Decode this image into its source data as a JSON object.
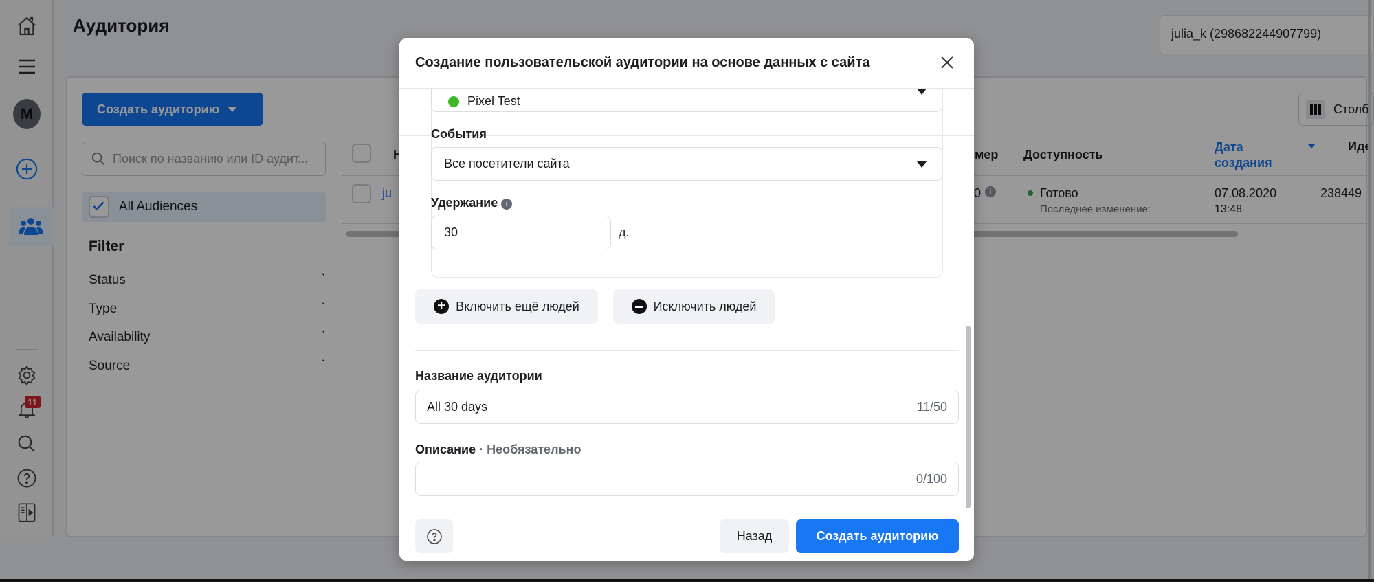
{
  "page": {
    "title": "Аудитория",
    "account": "julia_k (298682244907799)"
  },
  "nav": {
    "avatar_letter": "M",
    "notifications": "11"
  },
  "toolbar": {
    "create_label": "Создать аудиторию",
    "columns_label": "Столб"
  },
  "sidebar": {
    "search_placeholder": "Поиск по названию или ID аудит...",
    "all_audiences": "All Audiences",
    "filter_title": "Filter",
    "filters": [
      "Status",
      "Type",
      "Availability",
      "Source"
    ]
  },
  "table": {
    "headers": {
      "name": "Н",
      "size": "мер",
      "availability": "Доступность",
      "date": "Дата создания",
      "id": "Иде"
    },
    "rows": [
      {
        "name": "ju",
        "size": "0",
        "status": "Готово",
        "status_sub": "Последнее изменение:",
        "date": "07.08.2020",
        "time": "13:48",
        "id": "238449"
      }
    ]
  },
  "colors": {
    "accent": "#1877f2",
    "status_ready": "#31a24c",
    "pixel_dot": "#42b72a"
  },
  "modal": {
    "title": "Создание пользовательской аудитории на основе данных с сайта",
    "pixel": "Pixel Test",
    "events_label": "События",
    "events_value": "Все посетители сайта",
    "retention_label": "Удержание",
    "retention_value": "30",
    "retention_unit": "д.",
    "include_label": "Включить ещё людей",
    "exclude_label": "Исключить людей",
    "name_label": "Название аудитории",
    "name_value": "All 30 days",
    "name_counter": "11/50",
    "desc_label": "Описание",
    "desc_optional": " · Необязательно",
    "desc_value": "",
    "desc_counter": "0/100",
    "back_label": "Назад",
    "create_label": "Создать аудиторию"
  }
}
